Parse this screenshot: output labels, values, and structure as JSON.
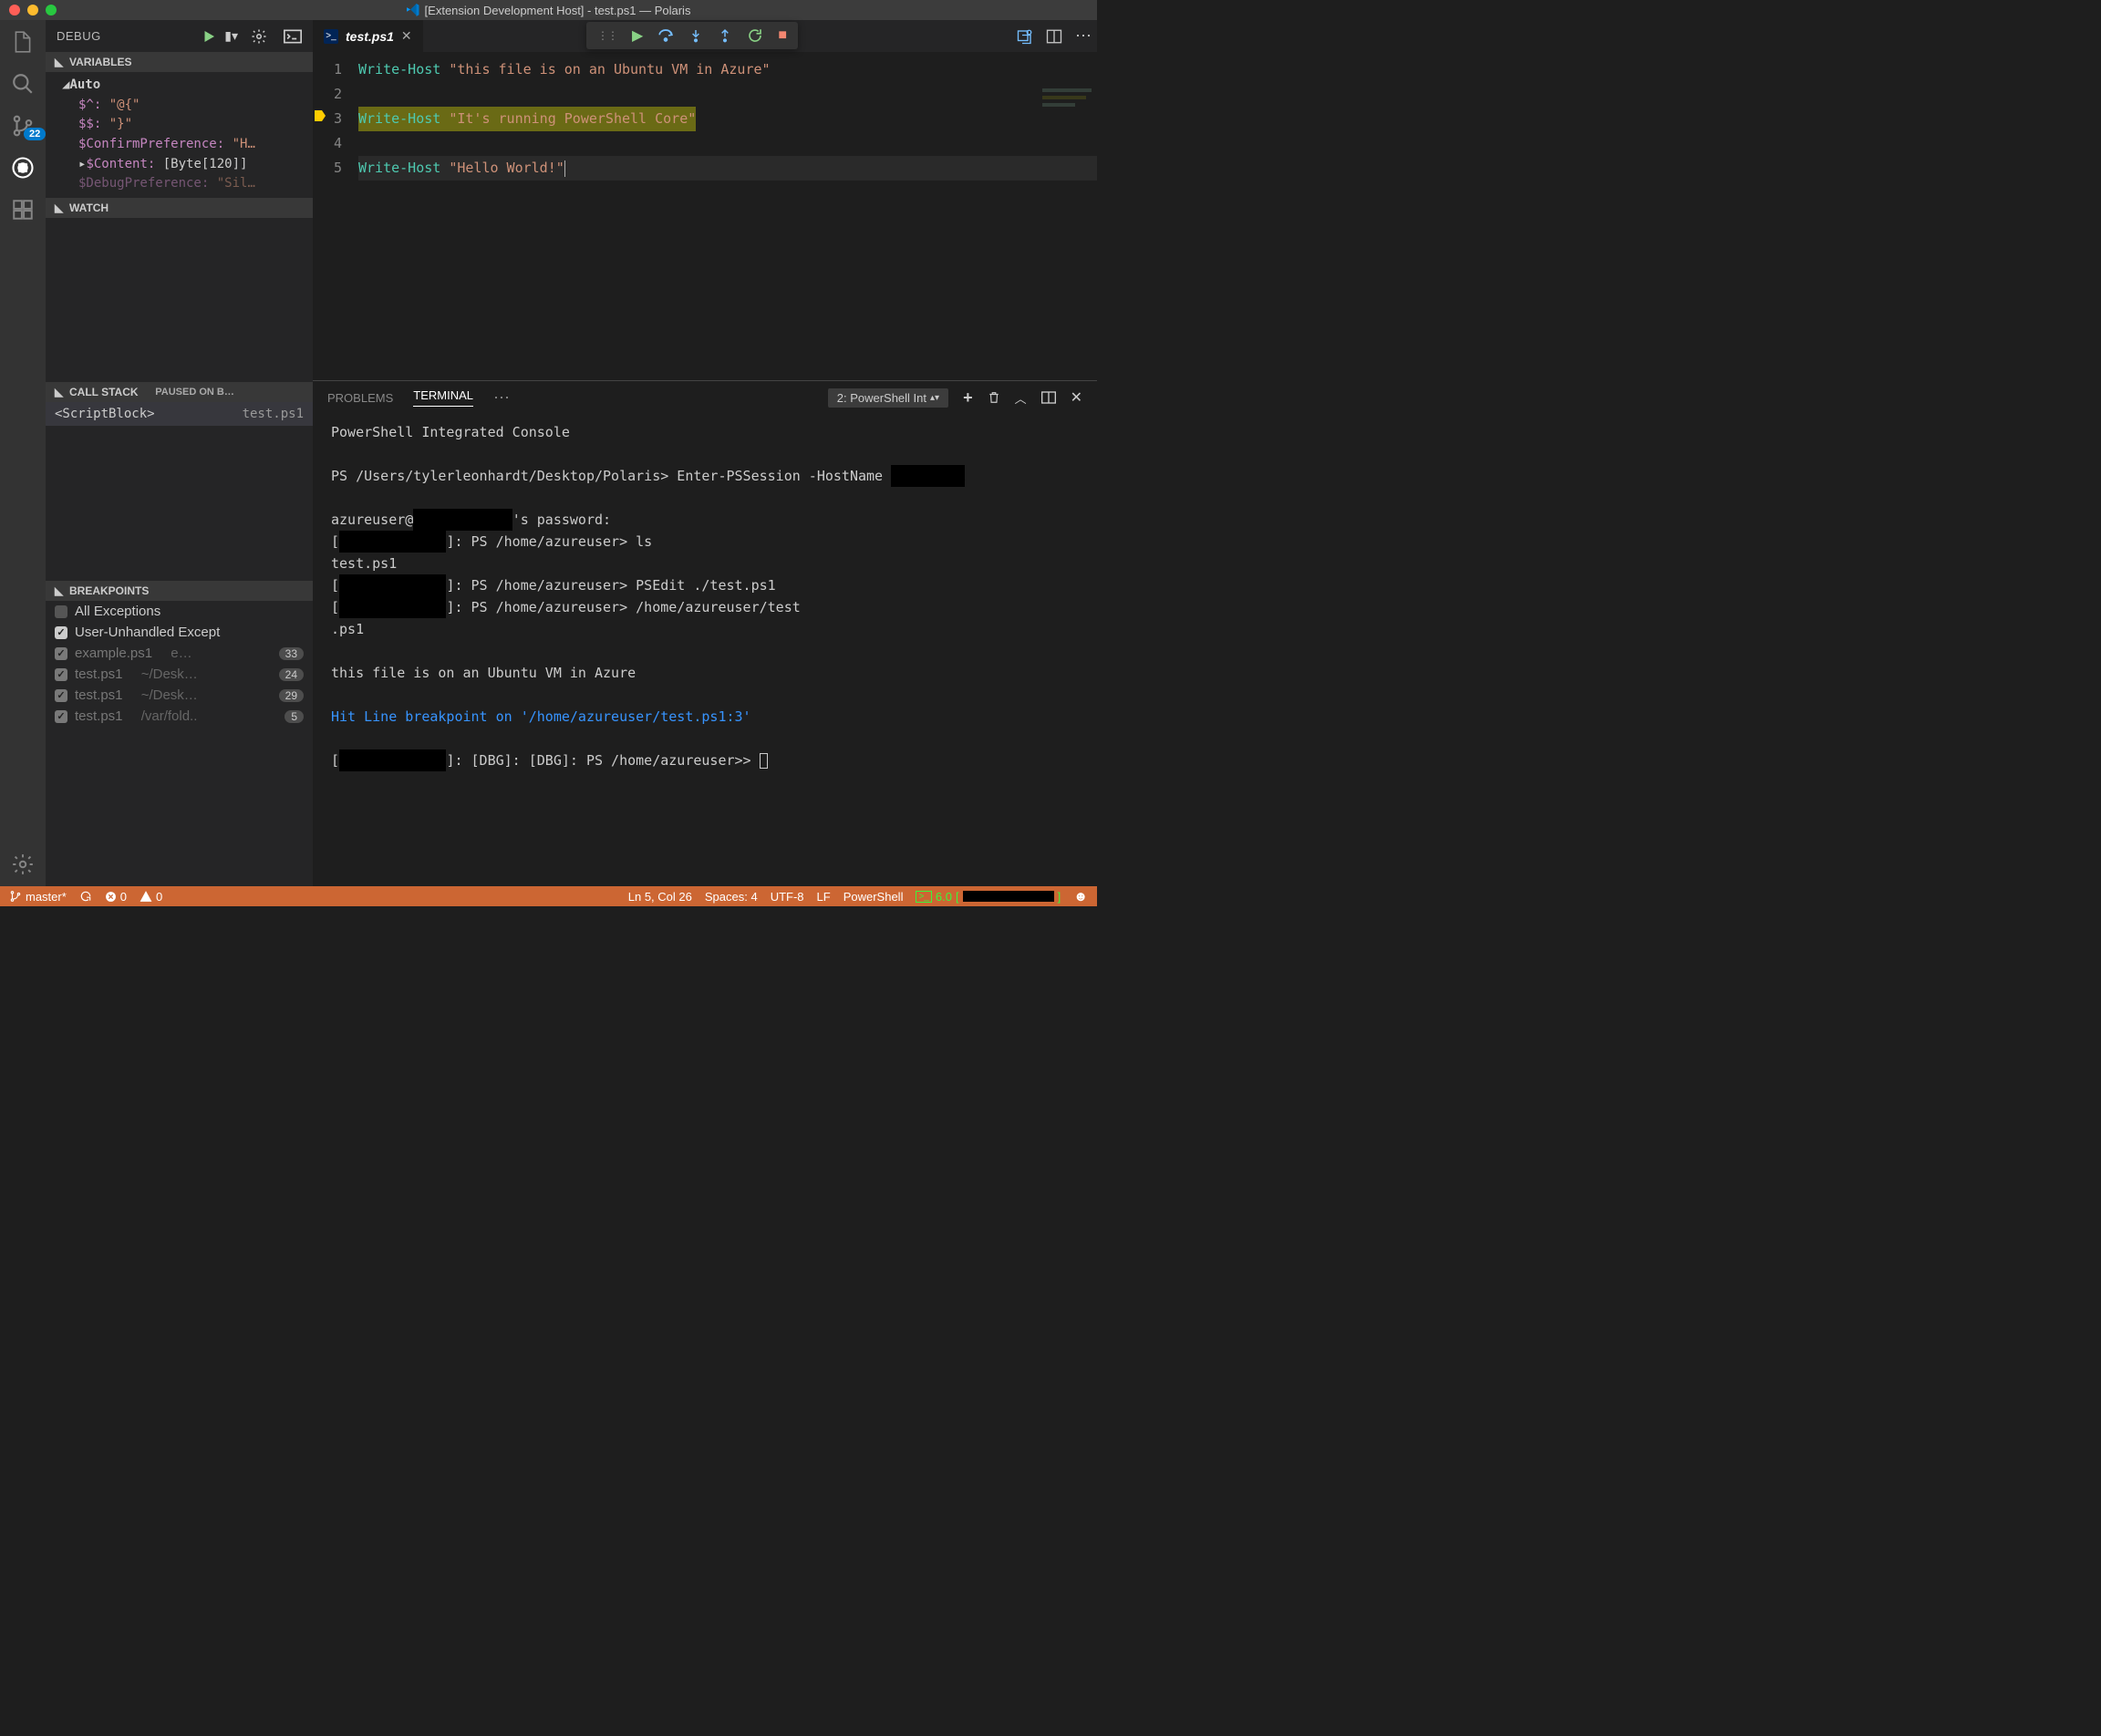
{
  "window": {
    "title": "[Extension Development Host] - test.ps1 — Polaris"
  },
  "activitybar": {
    "badge": "22"
  },
  "debug": {
    "title": "DEBUG",
    "sections": {
      "variables": "VARIABLES",
      "watch": "WATCH",
      "callstack": "CALL STACK",
      "callstack_status": "PAUSED ON B…",
      "breakpoints": "BREAKPOINTS"
    },
    "variables": {
      "group": "Auto",
      "items": [
        {
          "name": "$^:",
          "value": "\"@{\""
        },
        {
          "name": "$$:",
          "value": "\"}\""
        },
        {
          "name": "$ConfirmPreference:",
          "value": "\"H…"
        },
        {
          "name": "$Content:",
          "value": "[Byte[120]]",
          "expandable": true
        },
        {
          "name": "$DebugPreference:",
          "value": "\"Sil…"
        }
      ]
    },
    "callstack": {
      "frame": "<ScriptBlock>",
      "file": "test.ps1"
    },
    "breakpoints": {
      "allExceptions": "All Exceptions",
      "userUnhandled": "User-Unhandled Except",
      "items": [
        {
          "file": "example.ps1",
          "path": "e…",
          "count": "33"
        },
        {
          "file": "test.ps1",
          "path": "~/Desk…",
          "count": "24"
        },
        {
          "file": "test.ps1",
          "path": "~/Desk…",
          "count": "29"
        },
        {
          "file": "test.ps1",
          "path": "/var/fold..",
          "count": "5"
        }
      ]
    }
  },
  "tabs": {
    "file": "test.ps1"
  },
  "editor": {
    "lines": [
      {
        "n": "1",
        "cmd": "Write-Host",
        "str": "\"this file is on an Ubuntu VM in Azure\""
      },
      {
        "n": "2",
        "cmd": "",
        "str": ""
      },
      {
        "n": "3",
        "cmd": "Write-Host",
        "str": "\"It's running PowerShell Core\""
      },
      {
        "n": "4",
        "cmd": "",
        "str": ""
      },
      {
        "n": "5",
        "cmd": "Write-Host",
        "str": "\"Hello World!\""
      }
    ]
  },
  "panel": {
    "tabs": {
      "problems": "PROBLEMS",
      "terminal": "TERMINAL"
    },
    "terminalSelect": "2: PowerShell Int",
    "terminal": {
      "header": "PowerShell Integrated Console",
      "line1_prefix": "PS /Users/tylerleonhardt/Desktop/Polaris>",
      "line1_cmd": "Enter-PSSession -HostName ",
      "line2_a": "azureuser@",
      "line2_b": "'s password:",
      "line3_a": "[",
      "line3_b": "]: PS /home/azureuser> ls",
      "line4": "test.ps1",
      "line5_b": "]: PS /home/azureuser> PSEdit ./test.ps1",
      "line6_b": "]: PS /home/azureuser> /home/azureuser/test",
      "line6_c": ".ps1",
      "line8": "this file is on an Ubuntu VM in Azure",
      "line9": "Hit Line breakpoint on '/home/azureuser/test.ps1:3'",
      "line10_b": "]: [DBG]: [DBG]: PS /home/azureuser>> "
    }
  },
  "statusbar": {
    "branch": "master*",
    "errors": "0",
    "warnings": "0",
    "lncol": "Ln 5, Col 26",
    "spaces": "Spaces: 4",
    "encoding": "UTF-8",
    "eol": "LF",
    "lang": "PowerShell",
    "psver": "6.0"
  },
  "colors": {
    "traffic_red": "#ff5f57",
    "traffic_yellow": "#febc2e",
    "traffic_green": "#28c840"
  }
}
